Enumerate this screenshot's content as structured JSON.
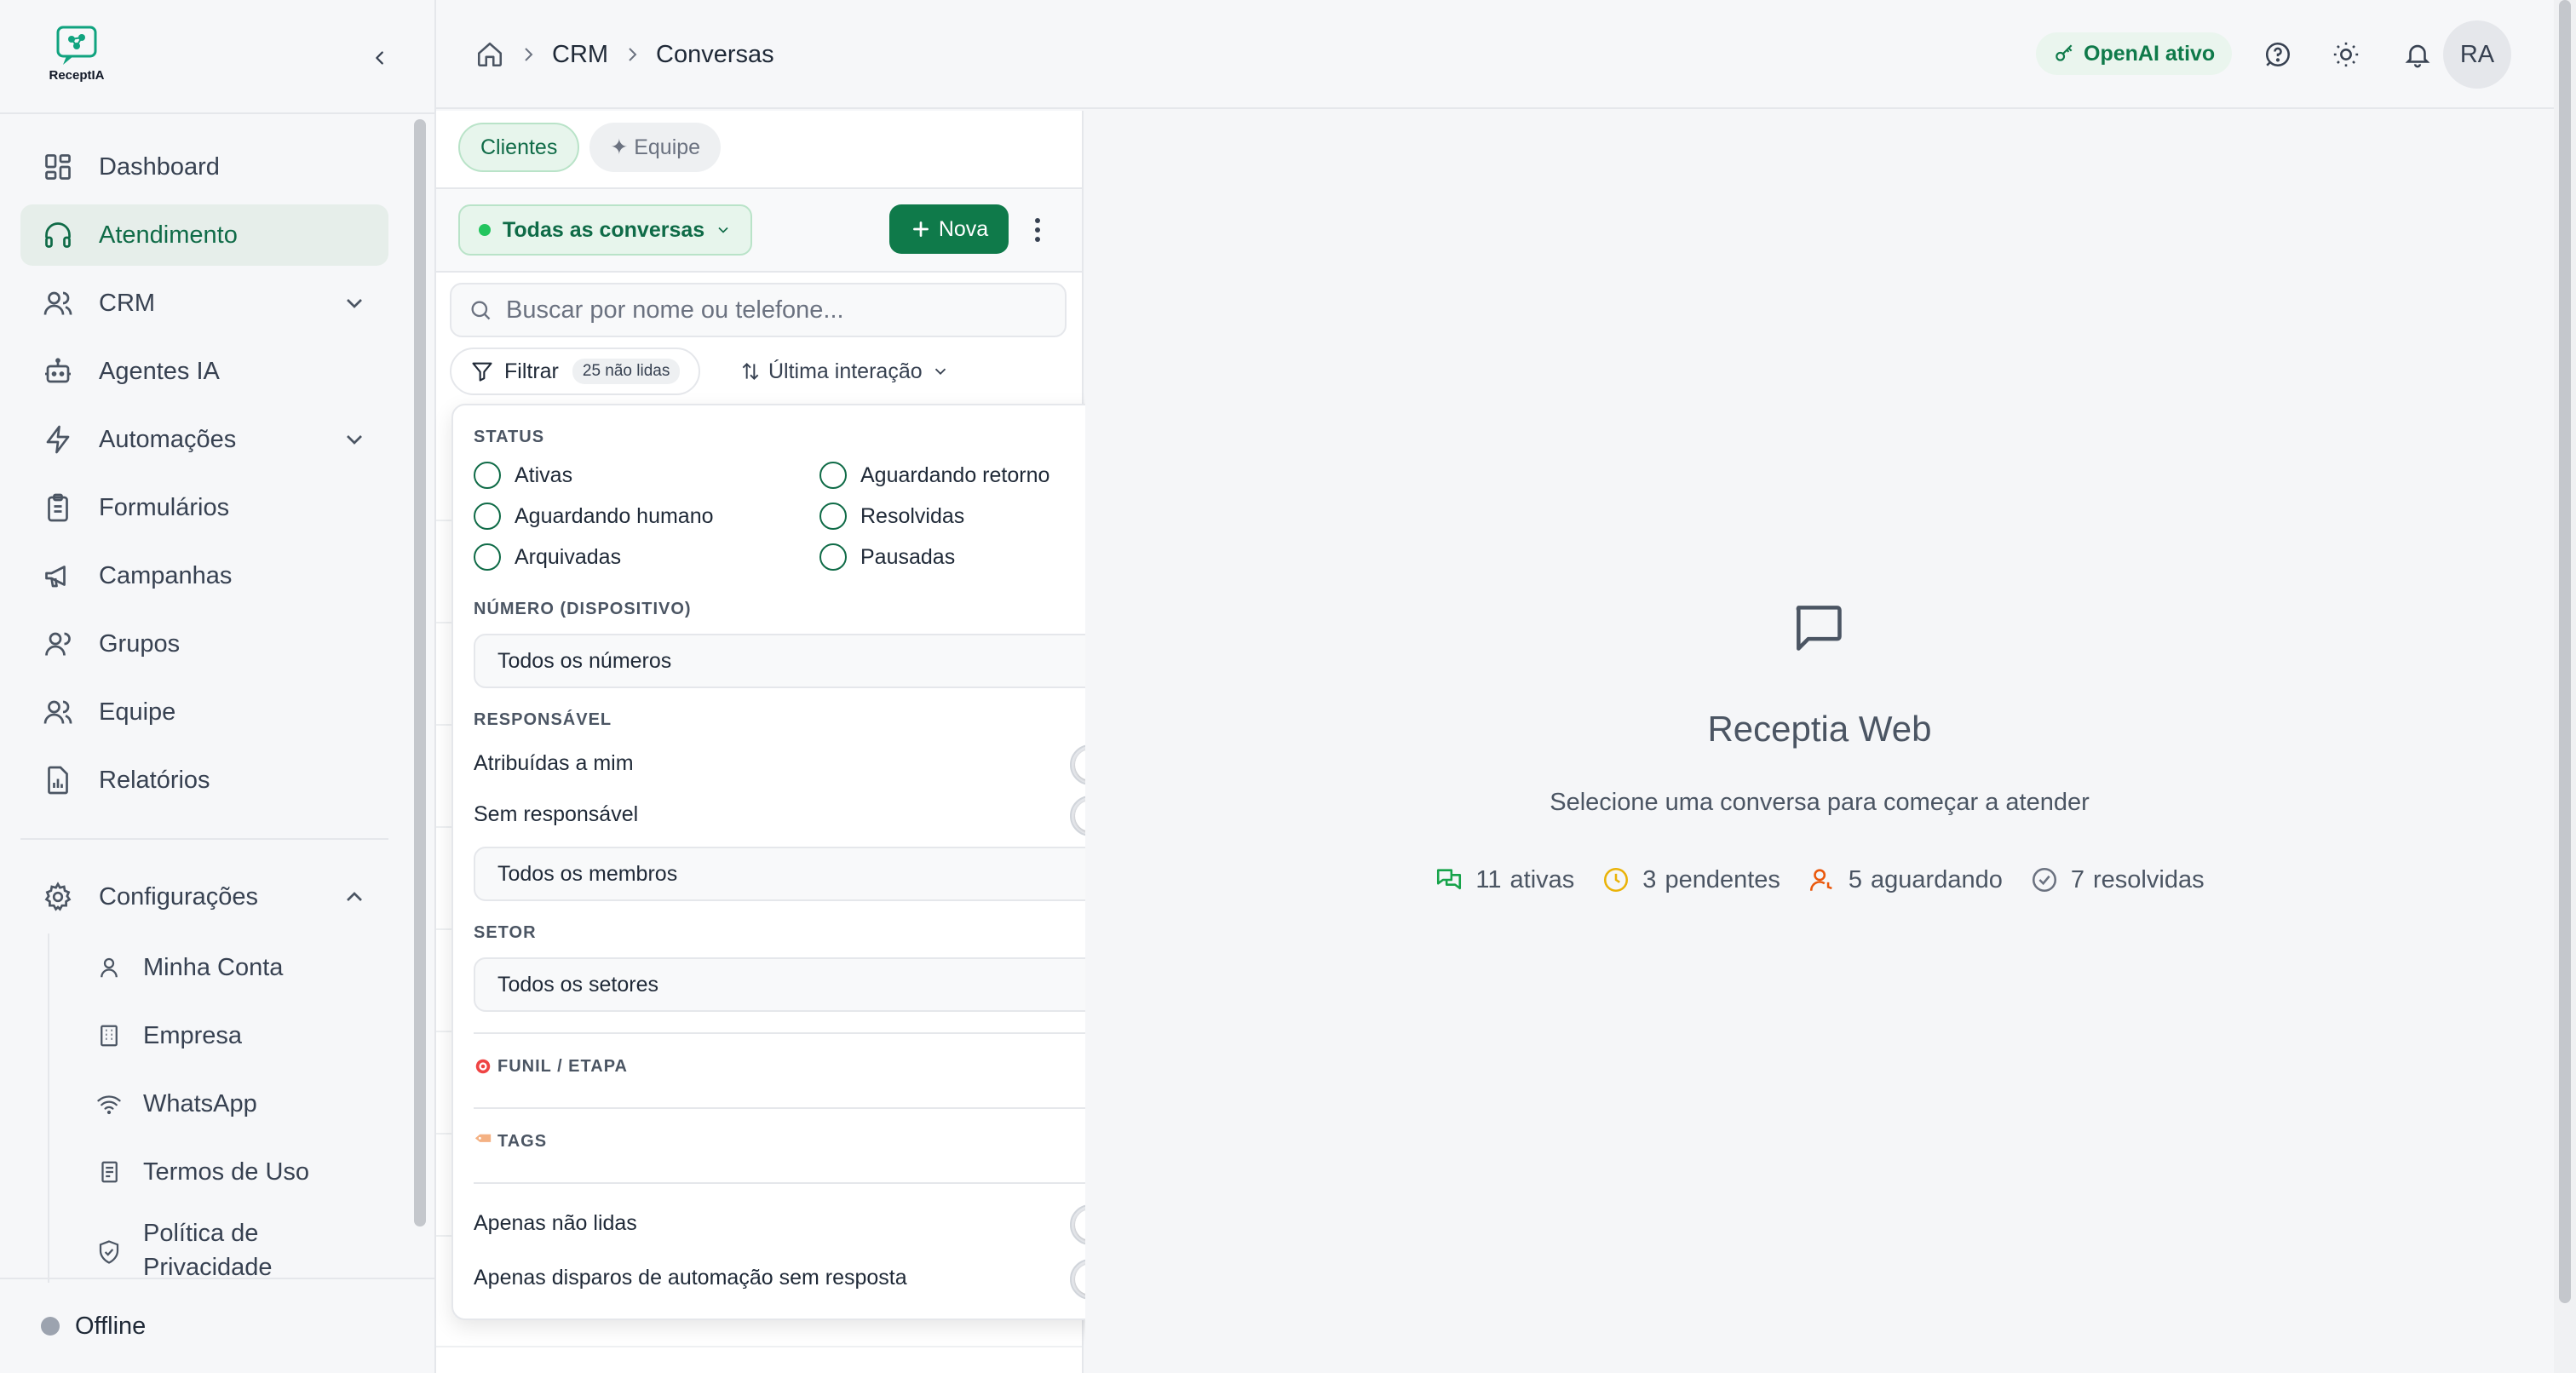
{
  "brand": {
    "name": "ReceptIA"
  },
  "sidebar": {
    "items": [
      {
        "label": "Dashboard",
        "icon": "dashboard-icon"
      },
      {
        "label": "Atendimento",
        "icon": "headphones-icon",
        "active": true
      },
      {
        "label": "CRM",
        "icon": "users-icon",
        "has_children": true
      },
      {
        "label": "Agentes IA",
        "icon": "bot-icon"
      },
      {
        "label": "Automações",
        "icon": "zap-icon",
        "has_children": true
      },
      {
        "label": "Formulários",
        "icon": "clipboard-icon"
      },
      {
        "label": "Campanhas",
        "icon": "megaphone-icon"
      },
      {
        "label": "Grupos",
        "icon": "group-icon"
      },
      {
        "label": "Equipe",
        "icon": "team-icon"
      },
      {
        "label": "Relatórios",
        "icon": "report-icon"
      }
    ],
    "config": {
      "label": "Configurações",
      "icon": "gear-icon",
      "children": [
        {
          "label": "Minha Conta",
          "icon": "user-icon"
        },
        {
          "label": "Empresa",
          "icon": "building-icon"
        },
        {
          "label": "WhatsApp",
          "icon": "wifi-icon"
        },
        {
          "label": "Termos de Uso",
          "icon": "scroll-icon"
        },
        {
          "label": "Política de Privacidade",
          "icon": "shield-icon"
        }
      ]
    },
    "status": "Offline"
  },
  "topbar": {
    "breadcrumb": [
      "CRM",
      "Conversas"
    ],
    "openai_badge": "OpenAI ativo",
    "avatar_initials": "RA"
  },
  "conversations": {
    "tabs": [
      {
        "label": "Clientes",
        "active": true
      },
      {
        "label": "✦ Equipe",
        "active": false
      }
    ],
    "scope_filter": "Todas as conversas",
    "new_button": "Nova",
    "search_placeholder": "Buscar por nome ou telefone...",
    "filter_button": "Filtrar",
    "unread_badge": "25 não lidas",
    "sort_label": "Última interação"
  },
  "filter_panel": {
    "status_label": "STATUS",
    "status_options": [
      "Ativas",
      "Aguardando retorno",
      "Aguardando humano",
      "Resolvidas",
      "Arquivadas",
      "Pausadas"
    ],
    "device_label": "NÚMERO (DISPOSITIVO)",
    "device_value": "Todos os números",
    "owner_label": "RESPONSÁVEL",
    "owner_toggles": [
      "Atribuídas a mim",
      "Sem responsável"
    ],
    "member_value": "Todos os membros",
    "sector_label": "SETOR",
    "sector_value": "Todos os setores",
    "funnel_label": "FUNIL / ETAPA",
    "tags_label": "TAGS",
    "bottom_toggles": [
      "Apenas não lidas",
      "Apenas disparos de automação sem resposta"
    ]
  },
  "empty_state": {
    "title": "Receptia Web",
    "subtitle": "Selecione uma conversa para começar a atender",
    "stats": [
      {
        "count": "11",
        "label": "ativas",
        "color": "#16a34a"
      },
      {
        "count": "3",
        "label": "pendentes",
        "color": "#eab308"
      },
      {
        "count": "5",
        "label": "aguardando",
        "color": "#ea580c"
      },
      {
        "count": "7",
        "label": "resolvidas",
        "color": "#6b7280"
      }
    ]
  },
  "colors": {
    "accent": "#0f7a4a",
    "accent_light": "#e7f5ec"
  }
}
